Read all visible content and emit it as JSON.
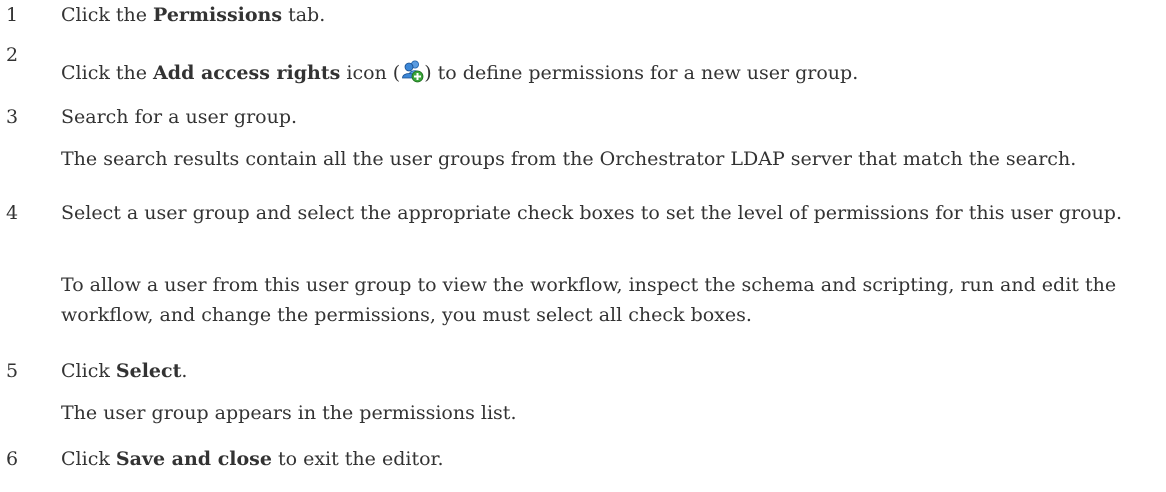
{
  "steps": [
    {
      "number": "1",
      "pre": "Click the ",
      "bold": "Permissions",
      "post": " tab."
    },
    {
      "number": "2",
      "pre": "Click the ",
      "bold": "Add access rights",
      "mid": " icon (",
      "icon": "add-users-icon",
      "post": ") to define permissions for a new user group."
    },
    {
      "number": "3",
      "text": "Search for a user group.",
      "note": "The search results contain all the user groups from the Orchestrator LDAP server that match the search."
    },
    {
      "number": "4",
      "text": "Select a user group and select the appropriate check boxes to set the level of permissions for this user group.",
      "note": "To allow a user from this user group to view the workflow, inspect the schema and scripting, run and edit the workflow, and change the permissions, you must select all check boxes."
    },
    {
      "number": "5",
      "pre": "Click ",
      "bold": "Select",
      "post": ".",
      "note": "The user group appears in the permissions list."
    },
    {
      "number": "6",
      "pre": "Click ",
      "bold": "Save and close",
      "post": " to exit the editor."
    }
  ],
  "colors": {
    "text": "#333333",
    "icon_blue": "#2f7fd1",
    "icon_green": "#3aa63a"
  }
}
